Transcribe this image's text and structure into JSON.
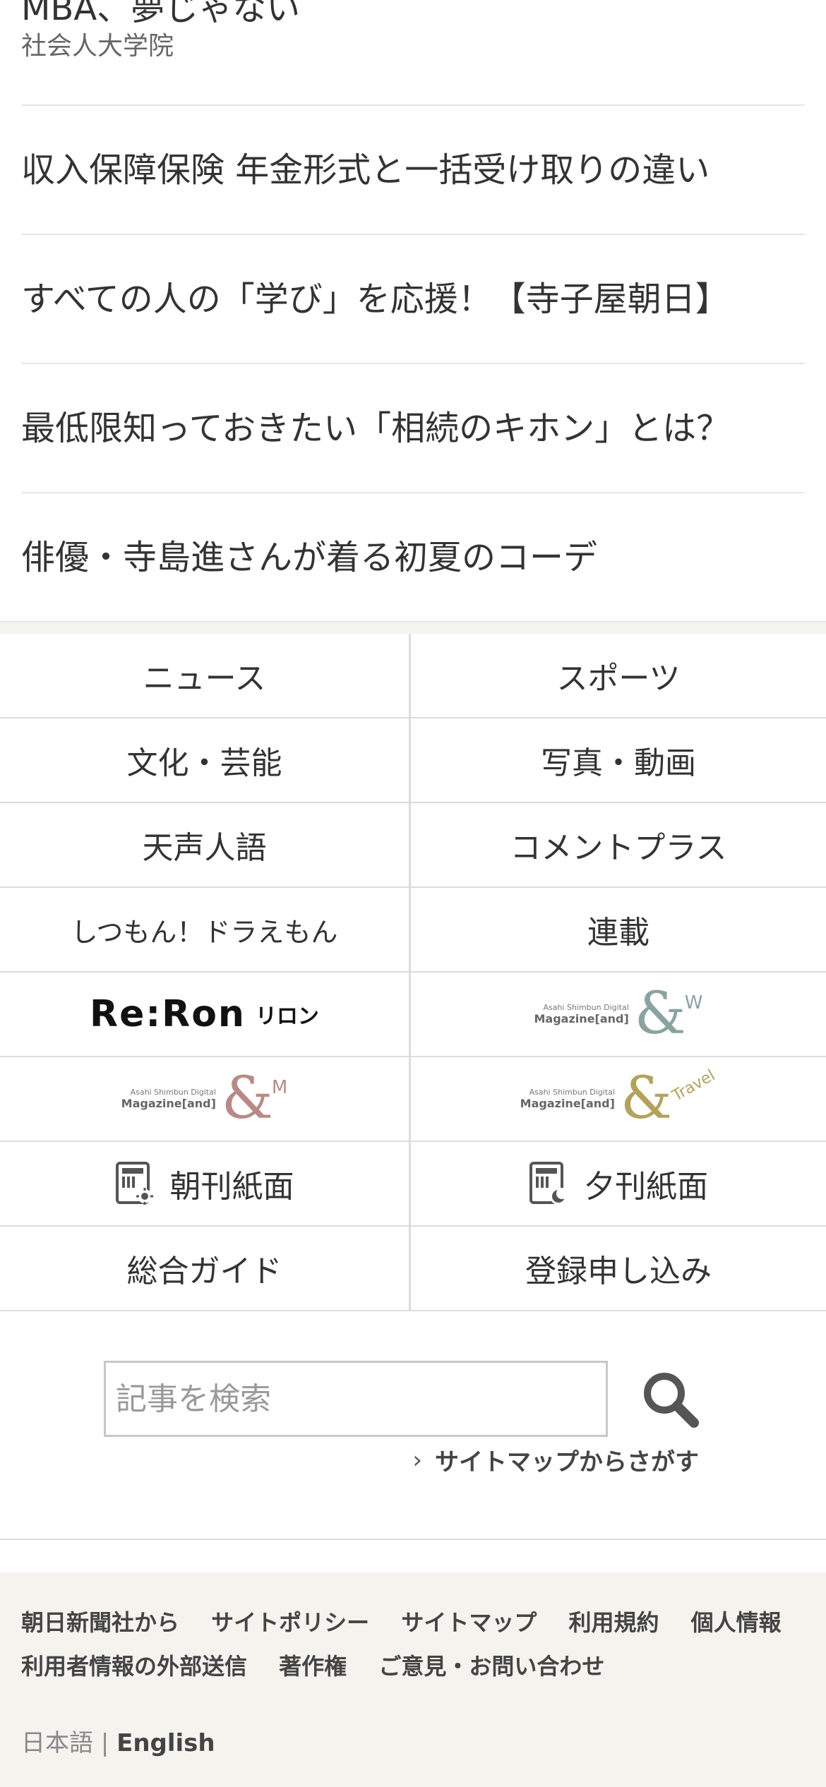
{
  "ads": [
    {
      "title": "MBA、夢じゃない",
      "sub": "社会人大学院"
    },
    {
      "title": "収入保障保険 年金形式と一括受け取りの違い"
    },
    {
      "title": "すべての人の「学び」を応援！【寺子屋朝日】"
    },
    {
      "title": "最低限知っておきたい「相続のキホン」とは？"
    },
    {
      "title": "俳優・寺島進さんが着る初夏のコーデ"
    }
  ],
  "nav": {
    "news": "ニュース",
    "sports": "スポーツ",
    "culture": "文化・芸能",
    "photo_video": "写真・動画",
    "tensei": "天声人語",
    "comment_plus": "コメントプラス",
    "doraemon": "しつもん！ドラえもん",
    "serial": "連載",
    "reron": "Re:Ron",
    "reron_kana": "リロン",
    "mag_brand_line1": "Asahi Shimbun Digital",
    "mag_brand_line2": "Magazine[and]",
    "and_w_suffix": "W",
    "and_m_suffix": "M",
    "and_travel_suffix": "Travel",
    "morning_paper": "朝刊紙面",
    "evening_paper": "夕刊紙面",
    "guide": "総合ガイド",
    "register": "登録申し込み"
  },
  "colors": {
    "and_w": "#8aa3a0",
    "and_m": "#b98a85",
    "and_travel": "#b3a25a",
    "reron_dot1": "#e36d8f",
    "reron_dot2": "#3fb3b0"
  },
  "search": {
    "placeholder": "記事を検索",
    "sitemap_link": "サイトマップからさがす"
  },
  "footer": {
    "links": [
      "朝日新聞社から",
      "サイトポリシー",
      "サイトマップ",
      "利用規約",
      "個人情報",
      "利用者情報の外部送信",
      "著作権",
      "ご意見・お問い合わせ"
    ],
    "lang_ja": "日本語",
    "lang_sep": "|",
    "lang_en": "English"
  }
}
